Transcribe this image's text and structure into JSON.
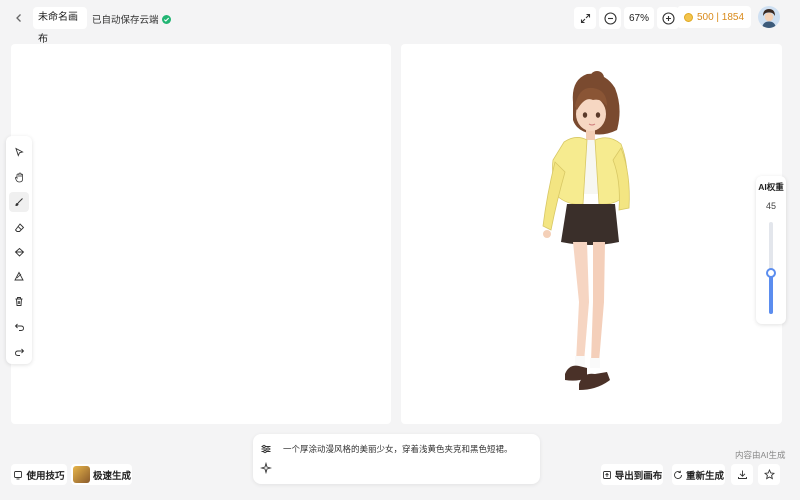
{
  "header": {
    "title": "未命名画布",
    "save_status": "已自动保存云端",
    "zoom": "67%",
    "credits": "500 | 1854",
    "credit_icon": "coin-icon"
  },
  "tools": [
    {
      "name": "select-tool",
      "icon": "pointer-icon"
    },
    {
      "name": "hand-tool",
      "icon": "hand-icon"
    },
    {
      "name": "brush-tool",
      "icon": "brush-icon"
    },
    {
      "name": "eraser-tool",
      "icon": "eraser-icon"
    },
    {
      "name": "fill-tool",
      "icon": "bucket-icon"
    },
    {
      "name": "shape-tool",
      "icon": "shapes-icon"
    },
    {
      "name": "clear-tool",
      "icon": "trash-icon"
    },
    {
      "name": "undo-tool",
      "icon": "undo-icon"
    },
    {
      "name": "redo-tool",
      "icon": "redo-icon"
    }
  ],
  "weight": {
    "title": "AI权重",
    "value": "45",
    "level": 0.45
  },
  "bottom": {
    "tips_label": "使用技巧",
    "fast_label": "极速生成",
    "prompt": "一个厚涂动漫风格的美丽少女，穿着浅黄色夹克和黑色短裙。",
    "ai_note": "内容由AI生成",
    "export_label": "导出到画布",
    "regen_label": "重新生成"
  },
  "colors": {
    "accent": "#5b8def",
    "saved": "#22b573",
    "credits": "#d98a1a"
  }
}
